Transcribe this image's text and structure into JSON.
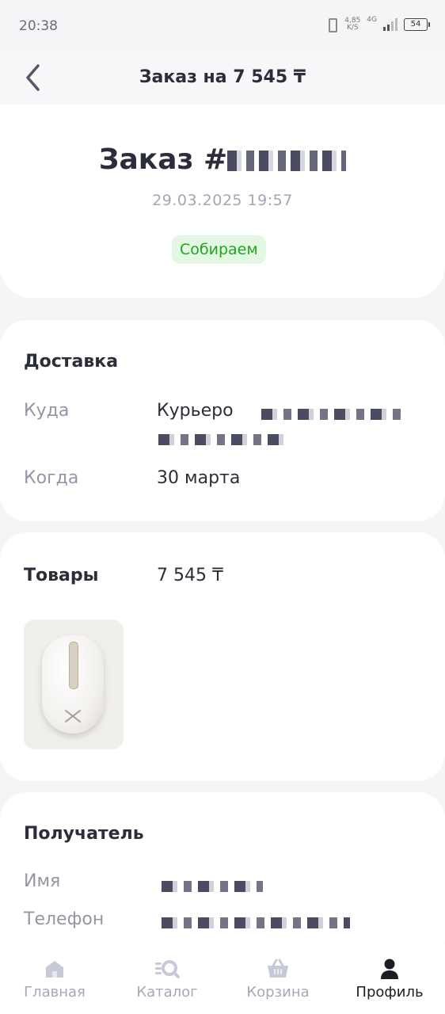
{
  "status_bar": {
    "time": "20:38",
    "speed_value": "4,85",
    "speed_unit": "K/S",
    "network": "4G",
    "battery": "54"
  },
  "header": {
    "back_icon": "chevron-left-icon",
    "title": "Заказ на 7 545 ₸"
  },
  "order": {
    "title": "Заказ #",
    "date": "29.03.2025 19:57",
    "status": "Собираем",
    "status_color": "#1ea71e",
    "status_bg": "#e3f7e3"
  },
  "delivery": {
    "title": "Доставка",
    "where_label": "Куда",
    "where_value": "Курьеро",
    "when_label": "Когда",
    "when_value": "30 марта"
  },
  "goods": {
    "title": "Товары",
    "total": "7 545 ₸"
  },
  "recipient": {
    "title": "Получатель",
    "name_label": "Имя",
    "phone_label": "Телефон"
  },
  "tabbar": {
    "items": [
      {
        "label": "Главная",
        "icon": "home-icon",
        "active": false
      },
      {
        "label": "Каталог",
        "icon": "catalog-search-icon",
        "active": false
      },
      {
        "label": "Корзина",
        "icon": "basket-icon",
        "active": false
      },
      {
        "label": "Профиль",
        "icon": "profile-icon",
        "active": true
      }
    ],
    "active_color": "#1c1d25",
    "inactive_color": "#a5a8b8"
  }
}
